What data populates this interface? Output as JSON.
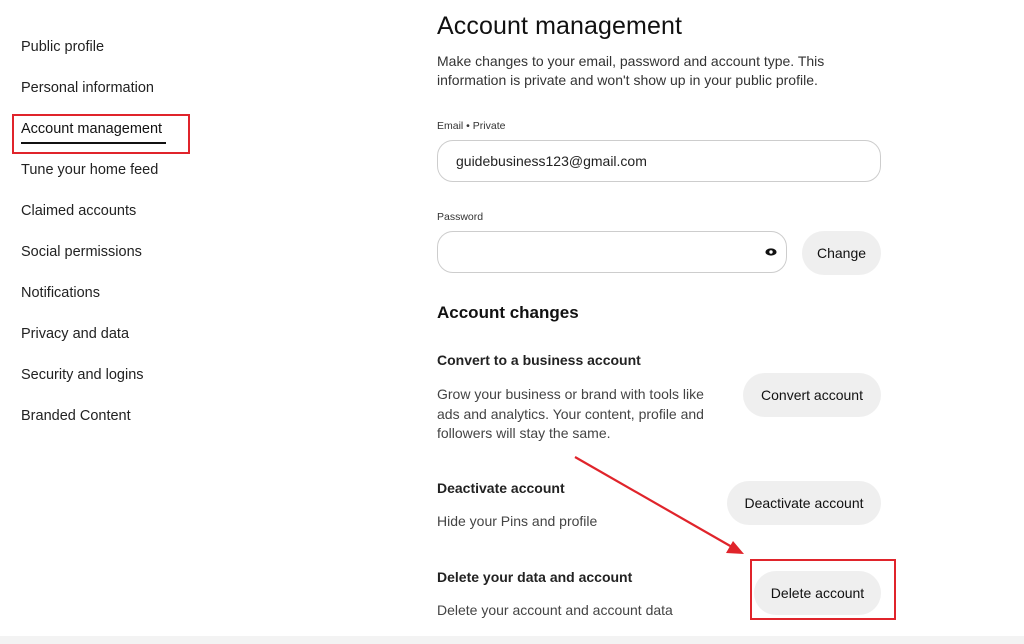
{
  "sidebar": {
    "items": [
      {
        "label": "Public profile"
      },
      {
        "label": "Personal information"
      },
      {
        "label": "Account management",
        "active": true
      },
      {
        "label": "Tune your home feed"
      },
      {
        "label": "Claimed accounts"
      },
      {
        "label": "Social permissions"
      },
      {
        "label": "Notifications"
      },
      {
        "label": "Privacy and data"
      },
      {
        "label": "Security and logins"
      },
      {
        "label": "Branded Content"
      }
    ]
  },
  "main": {
    "title": "Account management",
    "description": "Make changes to your email, password and account type. This information is private and won't show up in your public profile.",
    "email": {
      "label": "Email • Private",
      "value": "guidebusiness123@gmail.com"
    },
    "password": {
      "label": "Password",
      "value": "",
      "show_icon": "eye-icon",
      "change_label": "Change"
    },
    "account_changes": {
      "title": "Account changes",
      "items": [
        {
          "title": "Convert to a business account",
          "description": "Grow your business or brand with tools like ads and analytics. Your content, profile and followers will stay the same.",
          "button": "Convert account"
        },
        {
          "title": "Deactivate account",
          "description": "Hide your Pins and profile",
          "button": "Deactivate account"
        },
        {
          "title": "Delete your data and account",
          "description": "Delete your account and account data",
          "button": "Delete account"
        }
      ]
    }
  },
  "annotations": {
    "highlight_color": "#e0242b"
  }
}
